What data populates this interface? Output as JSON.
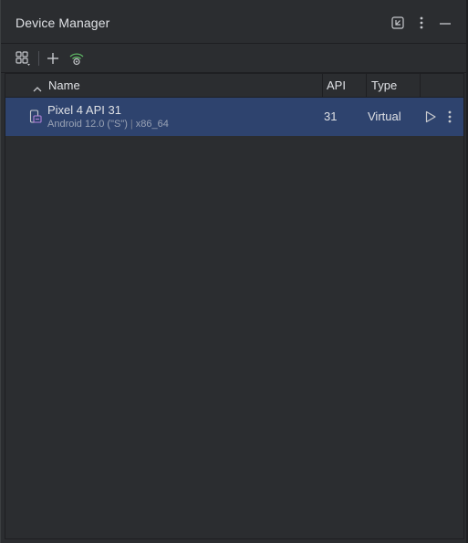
{
  "window": {
    "title": "Device Manager"
  },
  "titlebar_icons": [
    "collapse-to-corner-icon",
    "more-vertical-icon",
    "minimize-icon"
  ],
  "toolbar": {
    "tools": [
      "device-group-icon",
      "add-icon",
      "wifi-pair-icon"
    ]
  },
  "table": {
    "columns": [
      {
        "label": "Name",
        "sort": "ascending"
      },
      {
        "label": "API"
      },
      {
        "label": "Type"
      }
    ],
    "rows": [
      {
        "name": "Pixel 4 API 31",
        "os": "Android 12.0 (\"S\")",
        "separator": "|",
        "arch": "x86_64",
        "api": "31",
        "type": "Virtual",
        "selected": true
      }
    ]
  },
  "colors": {
    "background": "#2b2d30",
    "selection": "#2e436e",
    "text": "#dfe1e5",
    "accent_green": "#5fb865",
    "device_icon_purple": "#b180d7"
  }
}
